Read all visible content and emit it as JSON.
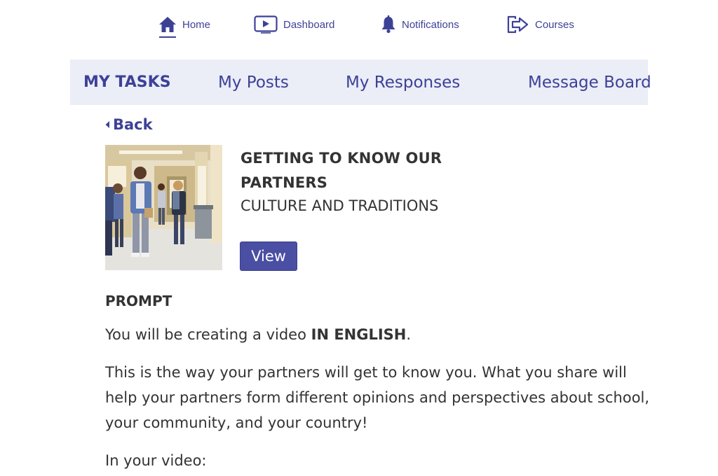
{
  "topnav": {
    "items": [
      {
        "label": "Home",
        "icon": "home-icon"
      },
      {
        "label": "Dashboard",
        "icon": "video-icon"
      },
      {
        "label": "Notifications",
        "icon": "bell-icon"
      },
      {
        "label": "Courses",
        "icon": "exit-icon"
      }
    ],
    "accent": "#3d4196"
  },
  "tabs": [
    {
      "label": "MY TASKS",
      "active": true
    },
    {
      "label": "My Posts"
    },
    {
      "label": "My Responses"
    },
    {
      "label": "Message Board"
    }
  ],
  "back_label": "Back",
  "task": {
    "title": "GETTING TO KNOW OUR PARTNERS",
    "subtitle": "CULTURE AND TRADITIONS",
    "view_label": "View",
    "image": "students-hallway-photo"
  },
  "prompt": {
    "heading": "PROMPT",
    "line1_prefix": "You will be creating a video ",
    "line1_bold": "IN ENGLISH",
    "line1_suffix": ".",
    "paragraph2": "This is the way your partners will get to know you. What you share will help your partners form different opinions and perspectives about school, your community, and your country!",
    "paragraph3": "In your video:"
  },
  "colors": {
    "tabbar_bg": "#ebedf7",
    "button_bg": "#4a4fa3"
  }
}
